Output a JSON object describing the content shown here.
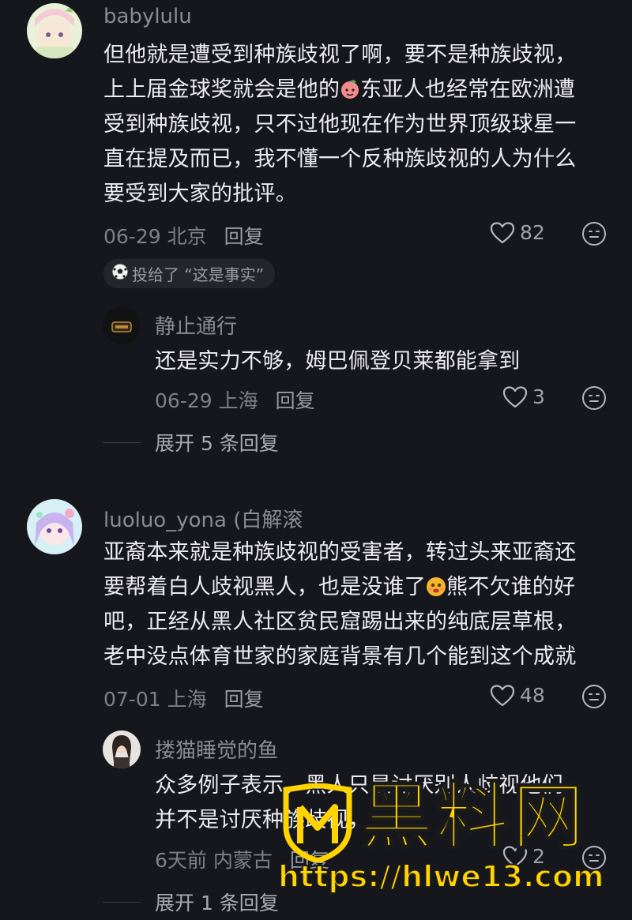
{
  "comments": [
    {
      "username": "babylulu",
      "text_line1": "但他就是遭受到种族歧视了啊，要不是种族歧视，",
      "text_line2a": "上上届金球奖就会是他的",
      "text_line2b": "东亚人也经常在欧洲遭",
      "text_line3": "受到种族歧视，只不过他现在作为世界顶级球星一",
      "text_line4": "直在提及而已，我不懂一个反种族歧视的人为什么",
      "text_line5": "要受到大家的批评。",
      "date_location": "06-29 北京",
      "reply_label": "回复",
      "likes": "82",
      "vote_tag": "投给了 “这是事实”",
      "sub_reply": {
        "username": "静止通行",
        "text": "还是实力不够，姆巴佩登贝莱都能拿到",
        "date_location": "06-29 上海",
        "reply_label": "回复",
        "likes": "3"
      },
      "expand_label": "展开 5 条回复"
    },
    {
      "username": "luoluo_yona (白解滚",
      "text_line1": "亚裔本来就是种族歧视的受害者，转过头来亚裔还",
      "text_line2a": "要帮着白人歧视黑人，也是没谁了",
      "text_line2b": "熊不欠谁的好",
      "text_line3": "吧，正经从黑人社区贫民窟踢出来的纯底层草根，",
      "text_line4": "老中没点体育世家的家庭背景有几个能到这个成就",
      "date_location": "07-01 上海",
      "reply_label": "回复",
      "likes": "48",
      "sub_reply": {
        "username": "搂猫睡觉的鱼",
        "text_line1": "众多例子表示，黑人只是讨厌别人歧视他们",
        "text_line2": "并不是讨厌种族歧视，",
        "date_location": "6天前 内蒙古",
        "reply_label": "回复",
        "likes": "2"
      },
      "expand_label": "展开 1 条回复"
    }
  ],
  "watermark": {
    "brand": "黑料网",
    "url": "https://hlwe13.com"
  },
  "colors": {
    "background": "#16161d",
    "watermark_yellow": "#ffd400"
  },
  "icons": [
    "heart-icon",
    "emoji-face-icon",
    "soccer-ball-icon"
  ]
}
